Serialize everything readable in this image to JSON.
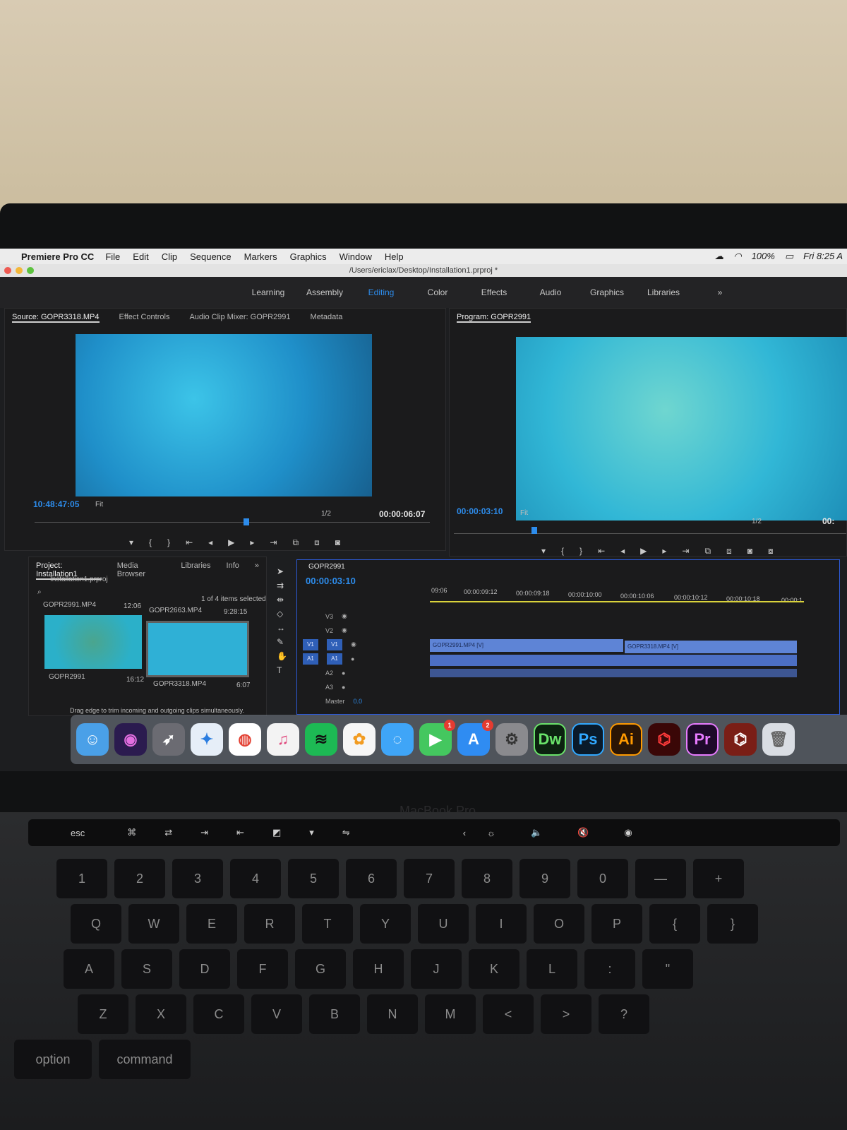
{
  "menubar": {
    "app_name": "Premiere Pro CC",
    "menus": [
      "File",
      "Edit",
      "Clip",
      "Sequence",
      "Markers",
      "Graphics",
      "Window",
      "Help"
    ],
    "battery": "100%",
    "clock": "Fri 8:25 A"
  },
  "window": {
    "title": "/Users/ericlax/Desktop/Installation1.prproj *"
  },
  "workspaces": {
    "items": [
      "Learning",
      "Assembly",
      "Editing",
      "Color",
      "Effects",
      "Audio",
      "Graphics",
      "Libraries"
    ],
    "active": "Editing",
    "more": "»"
  },
  "source_panel": {
    "tabs": [
      "Source: GOPR3318.MP4",
      "Effect Controls",
      "Audio Clip Mixer: GOPR2991",
      "Metadata"
    ],
    "timecode_left": "10:48:47:05",
    "fit": "Fit",
    "resolution": "1/2",
    "timecode_right": "00:00:06:07"
  },
  "program_panel": {
    "title": "Program: GOPR2991",
    "timecode_left": "00:00:03:10",
    "fit": "Fit",
    "resolution": "1/2",
    "timecode_right": "00:"
  },
  "project_panel": {
    "tabs": [
      "Project: Installation1",
      "Media Browser",
      "Libraries",
      "Info"
    ],
    "more": "»",
    "file": "Installation1.prproj",
    "selection": "1 of 4 items selected",
    "thumbs": [
      {
        "name": "GOPR2991.MP4",
        "duration": "12:06"
      },
      {
        "name": "GOPR2663.MP4",
        "duration": "9:28:15"
      },
      {
        "name": "GOPR2991",
        "duration": "16:12"
      },
      {
        "name": "GOPR3318.MP4",
        "duration": "6:07"
      }
    ],
    "status": "Drag edge to trim incoming and outgoing clips simultaneously."
  },
  "timeline": {
    "sequence": "GOPR2991",
    "timecode": "00:00:03:10",
    "ruler": [
      "09:06",
      "00:00:09:12",
      "00:00:09:18",
      "00:00:10:00",
      "00:00:10:06",
      "00:00:10:12",
      "00:00:10:18",
      "00:00:1"
    ],
    "tracks": [
      "V3",
      "V2",
      "V1",
      "A1",
      "A2",
      "A3"
    ],
    "targets": [
      "V1",
      "A1"
    ],
    "master": "Master",
    "master_value": "0.0",
    "clips": [
      {
        "label": "GOPR2991.MP4 [V]"
      },
      {
        "label": "GOPR3318.MP4 [V]"
      }
    ]
  },
  "dock": {
    "apps": [
      "Finder",
      "Siri",
      "Launchpad",
      "Safari",
      "Chrome",
      "iTunes",
      "Spotify",
      "Photos",
      "Messages",
      "FaceTime",
      "App Store",
      "System Preferences",
      "Dw",
      "Ps",
      "Ai",
      "Acrobat",
      "Pr",
      "Documents",
      "Trash"
    ],
    "facetime_badge": "1",
    "appstore_badge": "2"
  },
  "bezel": {
    "label": "MacBook Pro"
  },
  "keyboard": {
    "touchbar": [
      "esc"
    ],
    "row1": [
      "1",
      "2",
      "3",
      "4",
      "5",
      "6",
      "7",
      "8",
      "9",
      "0",
      "—",
      "+"
    ],
    "row2": [
      "Q",
      "W",
      "E",
      "R",
      "T",
      "Y",
      "U",
      "I",
      "O",
      "P",
      "{",
      "}"
    ],
    "row3": [
      "A",
      "S",
      "D",
      "F",
      "G",
      "H",
      "J",
      "K",
      "L",
      ":",
      "\""
    ],
    "row4": [
      "Z",
      "X",
      "C",
      "V",
      "B",
      "N",
      "M",
      "<",
      ">",
      "?"
    ],
    "row5": [
      "option",
      "command"
    ]
  },
  "colors": {
    "accent": "#2d8ceb",
    "clip_video": "#5e84d6",
    "clip_audio": "#4c6fc4",
    "timeline_border": "#2d5ad8"
  }
}
